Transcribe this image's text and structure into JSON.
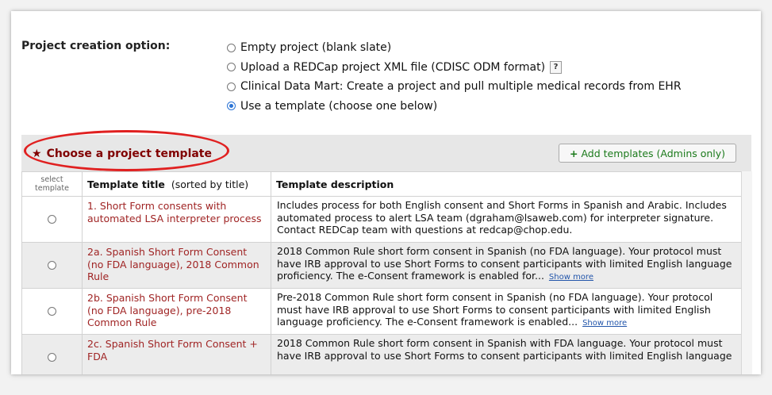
{
  "project_creation": {
    "label": "Project creation option:",
    "options": [
      {
        "label": "Empty project (blank slate)",
        "checked": false
      },
      {
        "label": "Upload a REDCap project XML file (CDISC ODM format)",
        "checked": false,
        "help": "?"
      },
      {
        "label": "Clinical Data Mart: Create a project and pull multiple medical records from EHR",
        "checked": false
      },
      {
        "label": "Use a template (choose one below)",
        "checked": true
      }
    ]
  },
  "templates": {
    "heading": "Choose a project template",
    "add_button": "Add templates (Admins only)",
    "columns": {
      "select_line1": "select",
      "select_line2": "template",
      "title": "Template title",
      "title_sub": "(sorted by title)",
      "description": "Template description"
    },
    "rows": [
      {
        "title": "1. Short Form consents with automated LSA interpreter process",
        "description": "Includes process for both English consent and Short Forms in Spanish and Arabic. Includes automated process to alert LSA team (dgraham@lsaweb.com) for interpreter signature. Contact REDCap team with questions at redcap@chop.edu.",
        "more": ""
      },
      {
        "title": "2a. Spanish Short Form Consent (no FDA language), 2018 Common Rule",
        "description": "2018 Common Rule short form consent in Spanish (no FDA language). Your protocol must have IRB approval to use Short Forms to consent participants with limited English language proficiency. The e-Consent framework is enabled for...",
        "more": "Show more"
      },
      {
        "title": "2b. Spanish Short Form Consent (no FDA language), pre-2018 Common Rule",
        "description": "Pre-2018 Common Rule short form consent in Spanish (no FDA language). Your protocol must have IRB approval to use Short Forms to consent participants with limited English language proficiency. The e-Consent framework is enabled...",
        "more": "Show more"
      },
      {
        "title": "2c. Spanish Short Form Consent + FDA",
        "description": "2018 Common Rule short form consent in Spanish with FDA language. Your protocol must have IRB approval to use Short Forms to consent participants with limited English language",
        "more": ""
      }
    ]
  },
  "colors": {
    "accent_red": "#800000",
    "highlight_ellipse": "#e02020",
    "radio_selected": "#2b74d6",
    "add_button_text": "#1b7a1b",
    "link_blue": "#2255aa"
  },
  "icons": {
    "heading": "star-icon",
    "add": "plus-icon",
    "help": "help-icon"
  }
}
